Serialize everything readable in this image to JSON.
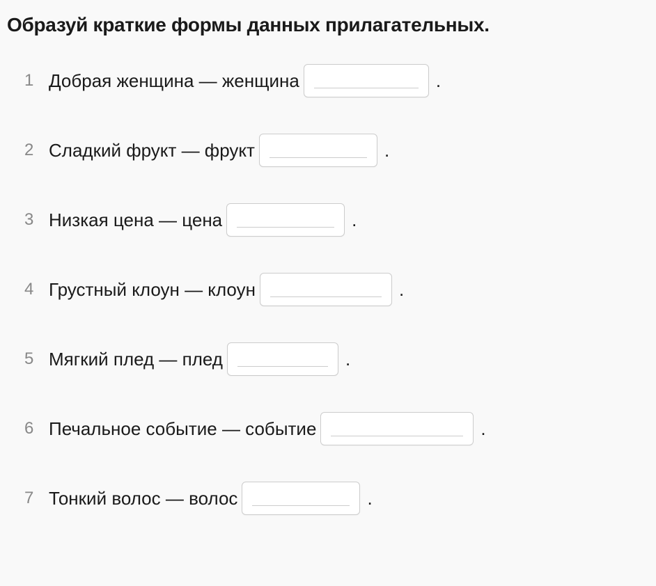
{
  "title": "Образуй краткие формы данных прилагательных.",
  "items": [
    {
      "num": "1",
      "before": "Добрая женщина — женщина",
      "after": "."
    },
    {
      "num": "2",
      "before": "Сладкий фрукт — фрукт",
      "after": "."
    },
    {
      "num": "3",
      "before": "Низкая цена — цена",
      "after": "."
    },
    {
      "num": "4",
      "before": "Грустный клоун — клоун",
      "after": "."
    },
    {
      "num": "5",
      "before": "Мягкий плед — плед",
      "after": "."
    },
    {
      "num": "6",
      "before": "Печальное событие — событие",
      "after": "."
    },
    {
      "num": "7",
      "before": "Тонкий волос — волос",
      "after": "."
    }
  ]
}
